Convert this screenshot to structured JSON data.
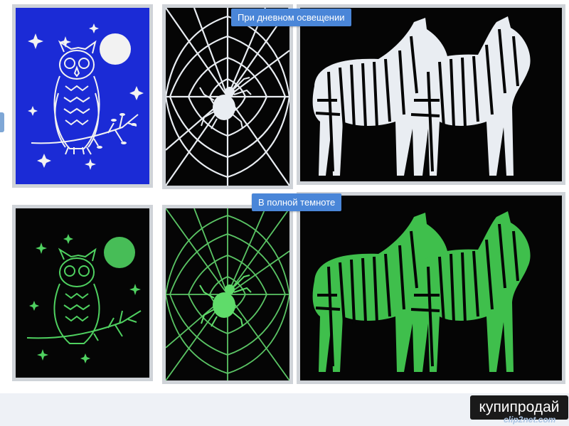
{
  "captions": {
    "daylight": "При дневном освещении",
    "darkness": "В полной темноте"
  },
  "watermark": {
    "brand": "купипродай",
    "source": "clip2net.com"
  },
  "colors": {
    "owl_day_bg": "#1b2bd6",
    "dark_bg": "#050505",
    "day_line": "#e9edf2",
    "glow": "#4fd160",
    "caption_bg": "#4a86d8"
  },
  "panels": {
    "row_top": [
      "owl-blue",
      "spider-web-white",
      "zebras-white"
    ],
    "row_bottom": [
      "owl-glow",
      "spider-web-glow",
      "zebras-glow"
    ]
  }
}
